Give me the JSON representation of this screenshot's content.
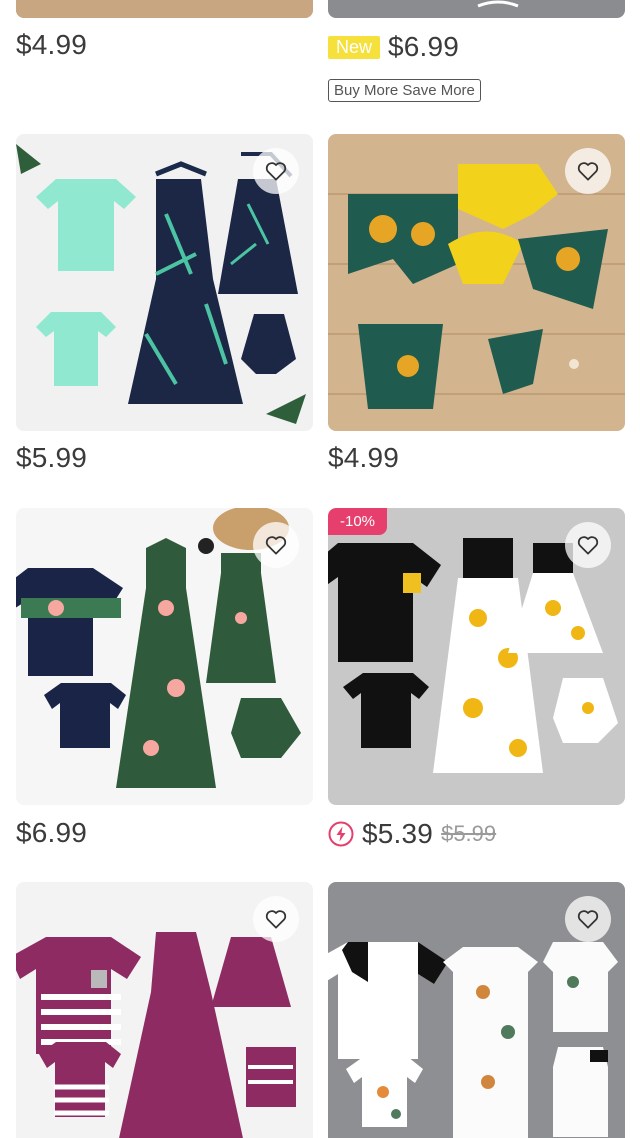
{
  "products": [
    {
      "price": "$4.99"
    },
    {
      "badge": "New",
      "price": "$6.99",
      "promo": "Buy More Save More"
    },
    {
      "price": "$5.99"
    },
    {
      "price": "$4.99"
    },
    {
      "price": "$6.99"
    },
    {
      "discount": "-10%",
      "price": "$5.39",
      "old_price": "$5.99"
    },
    {},
    {}
  ],
  "icons": {
    "wishlist": "heart-outline-icon",
    "flash_sale": "lightning-icon"
  },
  "colors": {
    "discount_badge": "#e63e6d",
    "new_badge": "#f5e03c",
    "flash_icon": "#e63e6d"
  }
}
